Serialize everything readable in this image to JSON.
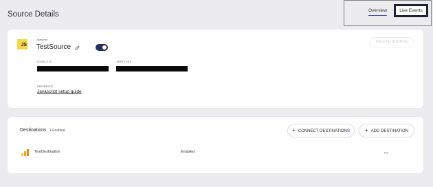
{
  "page": {
    "title": "Source Details"
  },
  "tabs": {
    "overview": "Overview",
    "live_events": "Live Events"
  },
  "source": {
    "logo_text": "JS",
    "type_label": "Javascript",
    "name": "TestSource",
    "enabled": true,
    "delete_label": "DELETE SOURCE",
    "source_id_label": "SOURCE ID",
    "write_key_label": "WRITE KEY",
    "reference_label": "REFERENCE",
    "reference_link": "Javascript setup guide"
  },
  "destinations": {
    "title": "Destinations",
    "count_text": "1 Enabled",
    "connect_label": "CONNECT DESTINATIONS",
    "add_label": "ADD DESTINATION",
    "rows": [
      {
        "name": "TestDestination",
        "status": "Enabled",
        "icon": "bars-icon",
        "more": "..."
      }
    ]
  },
  "colors": {
    "accent": "#26305a",
    "js_yellow": "#f6d64a",
    "dest_icon": "#f2a516"
  }
}
